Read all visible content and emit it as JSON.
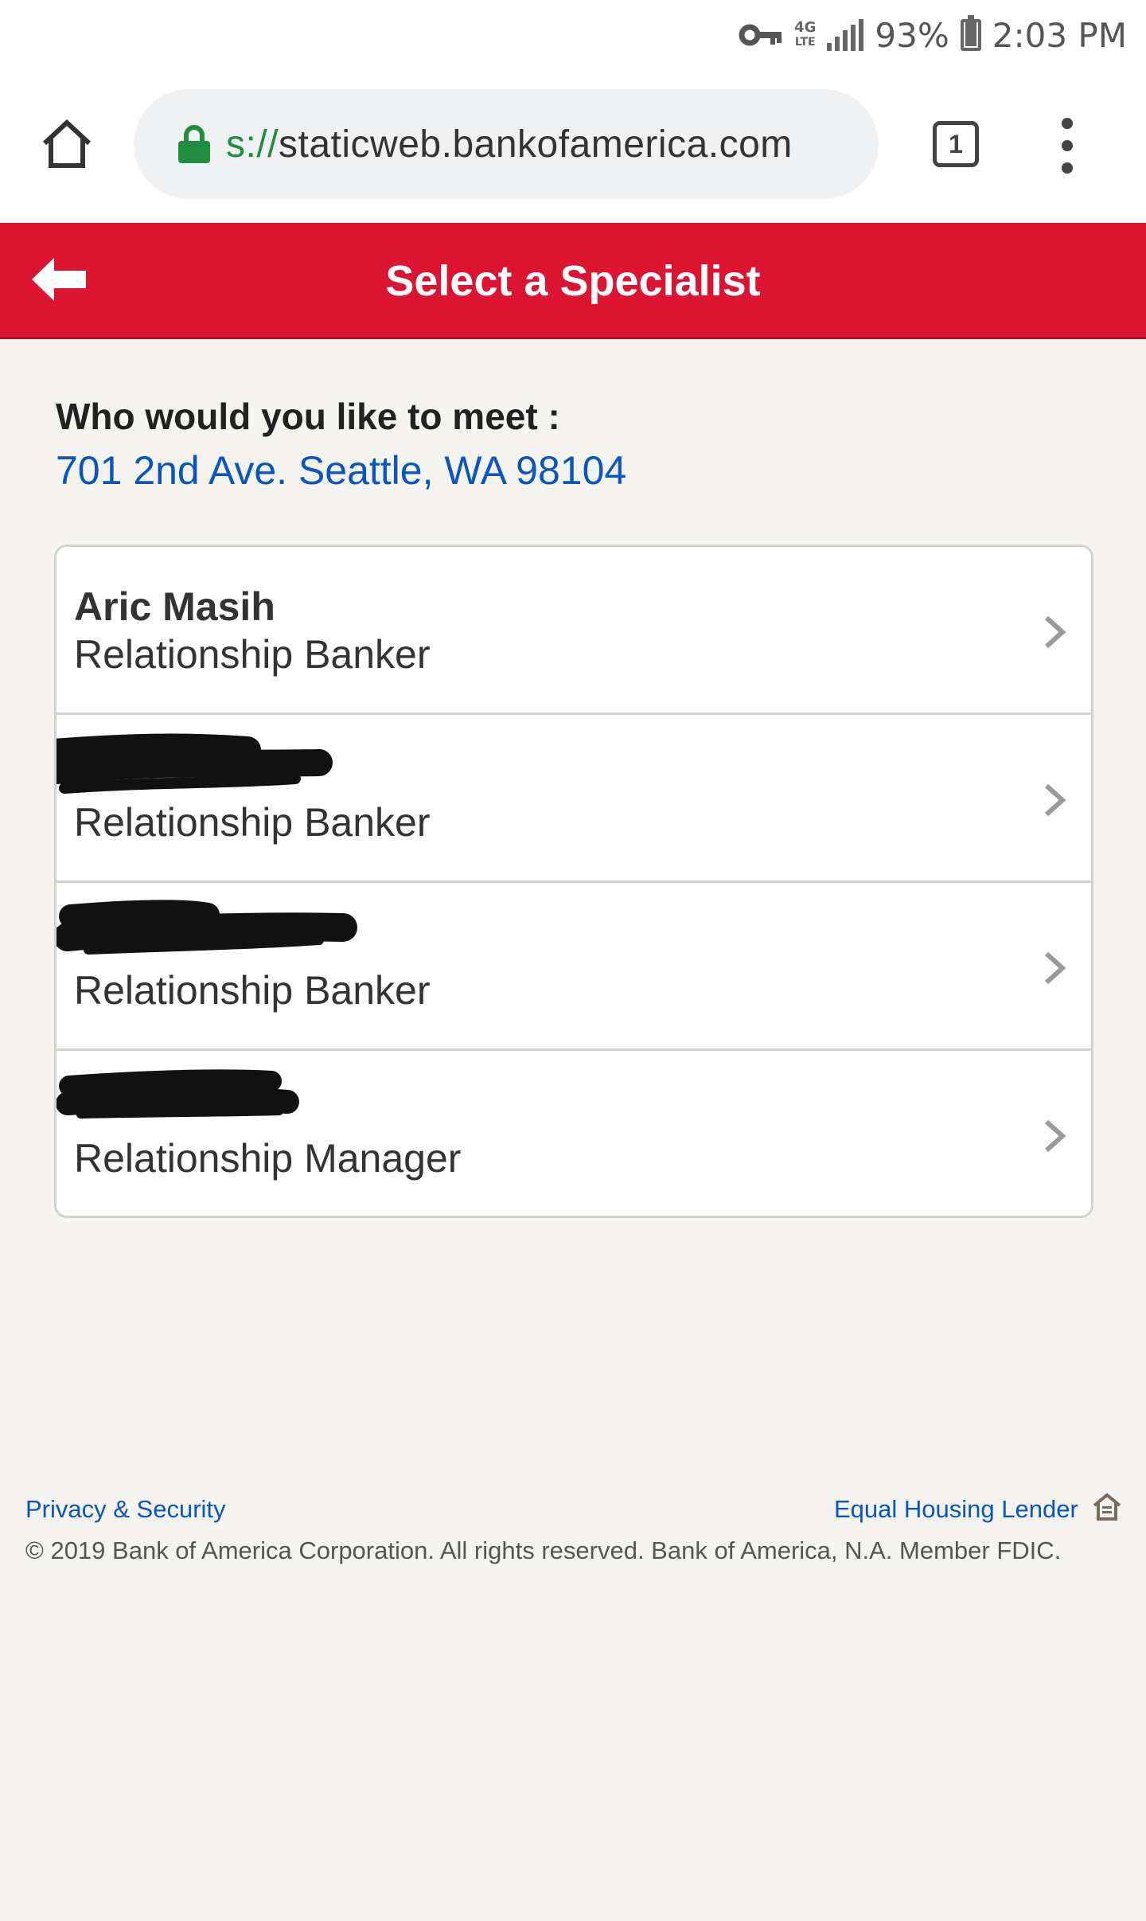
{
  "status_bar": {
    "network_type": "4G",
    "network_sub": "LTE",
    "battery_percent": "93%",
    "time": "2:03 PM"
  },
  "browser": {
    "url_scheme": "s://",
    "url_host": "staticweb.bankofamerica.com",
    "tab_count": "1"
  },
  "header": {
    "title": "Select a Specialist",
    "background_color": "#dc1431"
  },
  "content": {
    "prompt": "Who would you like to meet :",
    "address": "701 2nd Ave. Seattle, WA 98104",
    "specialists": [
      {
        "name": "Aric Masih",
        "title": "Relationship Banker",
        "redacted": false
      },
      {
        "name": "",
        "title": "Relationship Banker",
        "redacted": true
      },
      {
        "name": "",
        "title": "Relationship Banker",
        "redacted": true
      },
      {
        "name": "",
        "title": "Relationship Manager",
        "redacted": true
      }
    ]
  },
  "footer": {
    "privacy_link": "Privacy & Security",
    "ehl_link": "Equal Housing Lender",
    "copyright": "© 2019 Bank of America Corporation. All rights reserved. Bank of America, N.A. Member FDIC."
  },
  "colors": {
    "link": "#0a55c4",
    "lock_green": "#1e8e3e",
    "page_background": "#f5f4f1"
  }
}
